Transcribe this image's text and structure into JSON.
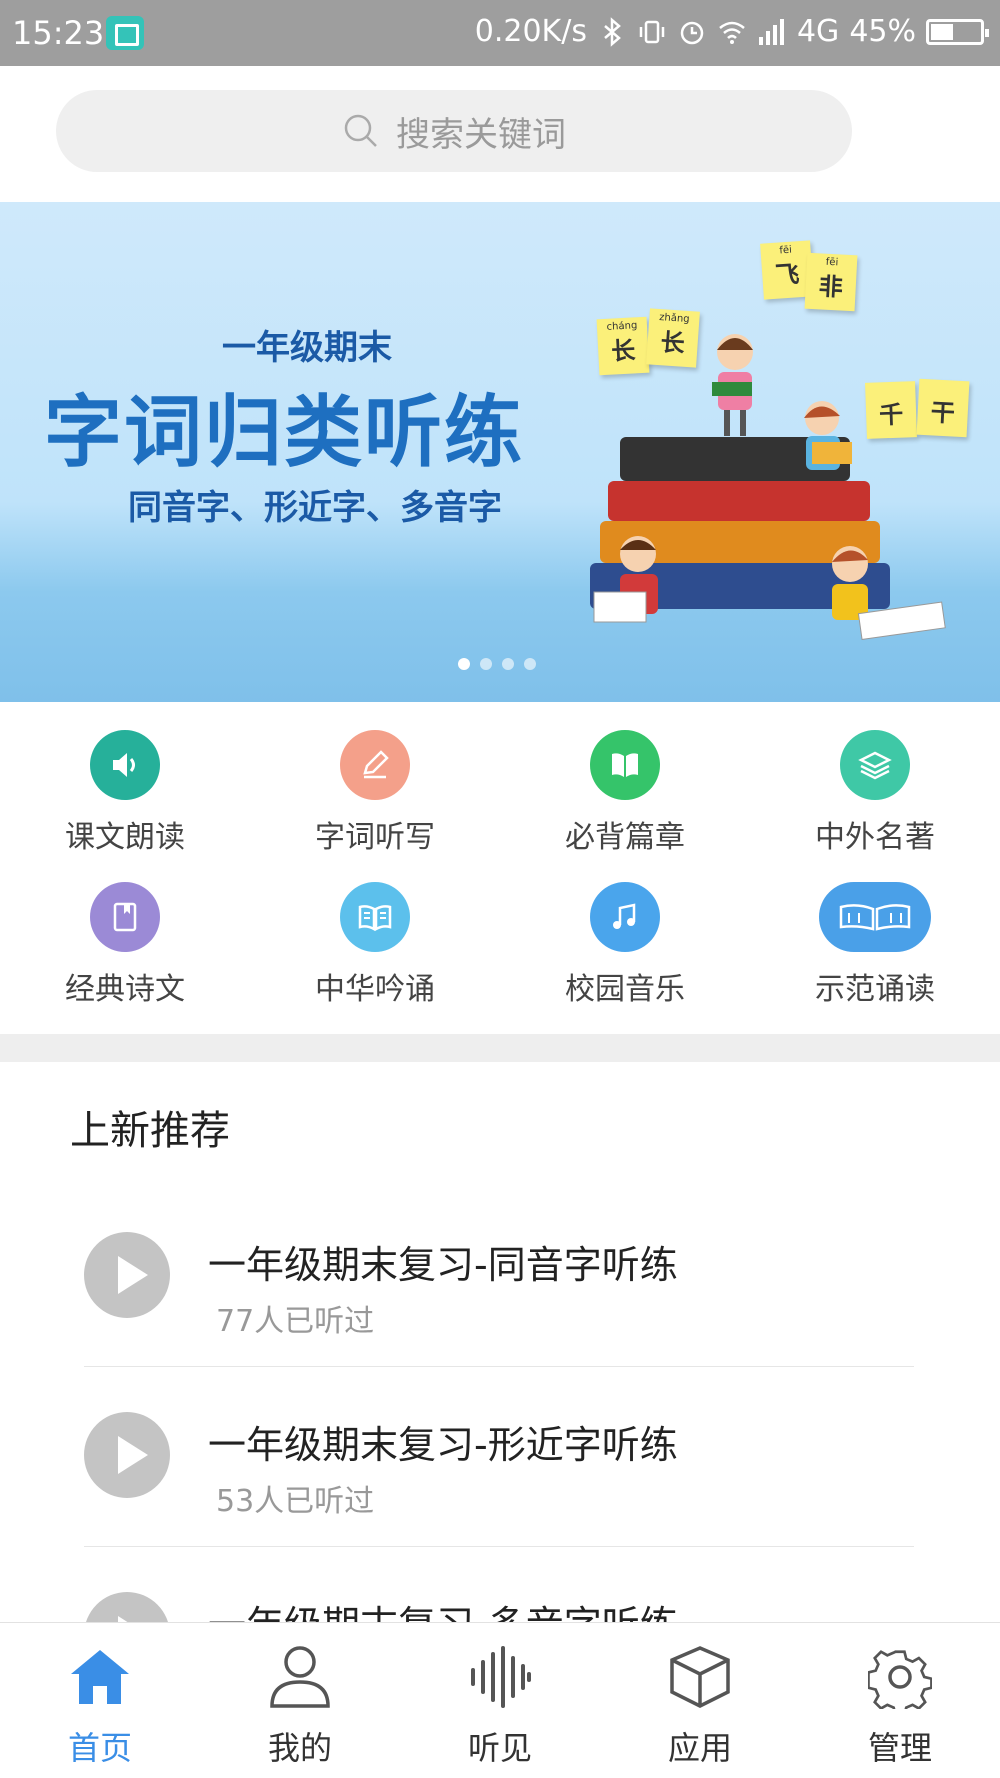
{
  "status_bar": {
    "time": "15:23",
    "net_speed": "0.20K/s",
    "network": "4G",
    "battery": "45%",
    "battery_level": 0.45,
    "icons": [
      "screenshot-icon",
      "bluetooth-icon",
      "vibrate-icon",
      "alarm-icon",
      "wifi-icon",
      "signal-icon",
      "battery-icon"
    ]
  },
  "search": {
    "placeholder": "搜索关键词"
  },
  "banner": {
    "subtitle": "一年级期末",
    "title": "字词归类听练",
    "tagline": "同音字、形近字、多音字",
    "cards": [
      {
        "pinyin": "fēi",
        "char": "飞"
      },
      {
        "pinyin": "fēi",
        "char": "非"
      },
      {
        "pinyin": "cháng",
        "char": "长"
      },
      {
        "pinyin": "zhǎng",
        "char": "长"
      },
      {
        "pinyin": "",
        "char": "千"
      },
      {
        "pinyin": "",
        "char": "干"
      }
    ],
    "page_count": 4,
    "active_page": 1
  },
  "categories": [
    {
      "label": "课文朗读",
      "icon": "speaker-icon",
      "color": "#26b09a"
    },
    {
      "label": "字词听写",
      "icon": "pencil-icon",
      "color": "#f4a08a"
    },
    {
      "label": "必背篇章",
      "icon": "book-icon",
      "color": "#35c46a"
    },
    {
      "label": "中外名著",
      "icon": "layers-icon",
      "color": "#3fc8a6"
    },
    {
      "label": "经典诗文",
      "icon": "bookmark-book-icon",
      "color": "#9b8ad6"
    },
    {
      "label": "中华吟诵",
      "icon": "open-book-icon",
      "color": "#5cc0ec"
    },
    {
      "label": "校园音乐",
      "icon": "music-note-icon",
      "color": "#4aa5ec"
    },
    {
      "label": "示范诵读",
      "icon": "reading-book-icon",
      "color": "#4aa0e8"
    }
  ],
  "new_section": {
    "title": "上新推荐",
    "items": [
      {
        "title": "一年级期末复习-同音字听练",
        "count": "77人已听过"
      },
      {
        "title": "一年级期末复习-形近字听练",
        "count": "53人已听过"
      },
      {
        "title": "一年级期末复习-多音字听练",
        "count": ""
      }
    ]
  },
  "bottom_nav": [
    {
      "label": "首页",
      "icon": "home-icon",
      "active": true
    },
    {
      "label": "我的",
      "icon": "user-icon",
      "active": false
    },
    {
      "label": "听见",
      "icon": "soundwave-icon",
      "active": false
    },
    {
      "label": "应用",
      "icon": "cube-icon",
      "active": false
    },
    {
      "label": "管理",
      "icon": "gear-icon",
      "active": false
    }
  ],
  "colors": {
    "accent": "#3a8ee6",
    "status_bar": "#9e9e9e"
  }
}
